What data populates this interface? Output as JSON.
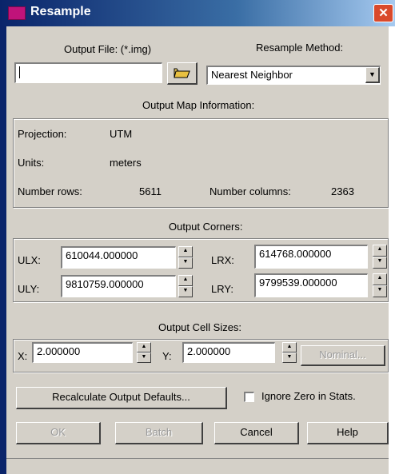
{
  "window": {
    "title": "Resample",
    "close_glyph": "✕"
  },
  "output_file": {
    "label": "Output File: (*.img)",
    "value": "",
    "browse_icon": "folder-open-icon"
  },
  "resample_method": {
    "label": "Resample Method:",
    "selected": "Nearest Neighbor"
  },
  "map_info": {
    "heading": "Output Map Information:",
    "projection_label": "Projection:",
    "projection_value": "UTM",
    "units_label": "Units:",
    "units_value": "meters",
    "rows_label": "Number rows:",
    "rows_value": "5611",
    "cols_label": "Number columns:",
    "cols_value": "2363"
  },
  "corners": {
    "heading": "Output Corners:",
    "ulx_label": "ULX:",
    "ulx_value": "610044.000000",
    "uly_label": "ULY:",
    "uly_value": "9810759.000000",
    "lrx_label": "LRX:",
    "lrx_value": "614768.000000",
    "lry_label": "LRY:",
    "lry_value": "9799539.000000"
  },
  "cell_sizes": {
    "heading": "Output Cell Sizes:",
    "x_label": "X:",
    "x_value": "2.000000",
    "y_label": "Y:",
    "y_value": "2.000000",
    "nominal_label": "Nominal..."
  },
  "recalculate_label": "Recalculate Output Defaults...",
  "ignore_zero": {
    "label": "Ignore Zero in Stats.",
    "checked": false
  },
  "buttons": {
    "ok": "OK",
    "batch": "Batch",
    "cancel": "Cancel",
    "help": "Help"
  },
  "colors": {
    "title_bar": "#0a246a",
    "dialog_bg": "#d4d0c8",
    "close": "#d9492b"
  }
}
